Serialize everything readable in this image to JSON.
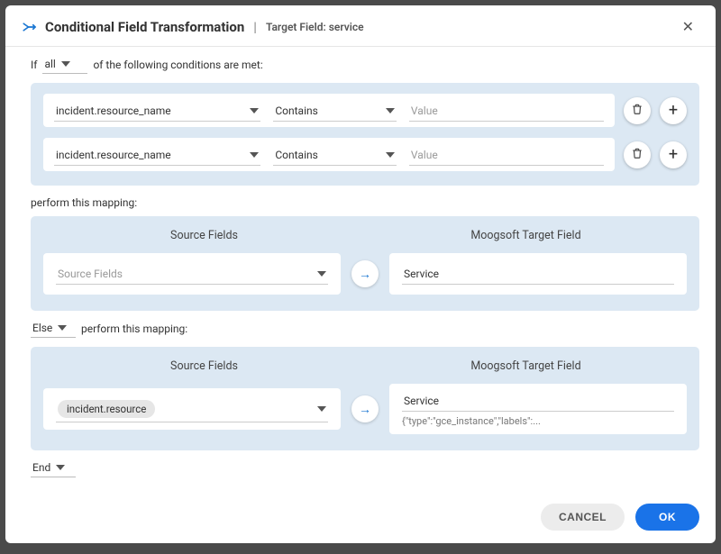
{
  "header": {
    "title": "Conditional Field Transformation",
    "target_label": "Target Field: service"
  },
  "if_clause": {
    "prefix": "If",
    "quantifier": "all",
    "suffix": "of the following conditions are met:"
  },
  "conditions": [
    {
      "field": "incident.resource_name",
      "operator": "Contains",
      "value_placeholder": "Value"
    },
    {
      "field": "incident.resource_name",
      "operator": "Contains",
      "value_placeholder": "Value"
    }
  ],
  "perform_label": "perform this mapping:",
  "map_headers": {
    "source": "Source Fields",
    "target": "Moogsoft Target Field"
  },
  "mapping_if": {
    "source_placeholder": "Source Fields",
    "target": "Service"
  },
  "else_clause": {
    "label": "Else",
    "suffix": "perform this mapping:"
  },
  "mapping_else": {
    "source_chip": "incident.resource",
    "target": "Service",
    "target_sub": "{\"type\":\"gce_instance\",\"labels\":..."
  },
  "end_label": "End",
  "buttons": {
    "cancel": "CANCEL",
    "ok": "OK"
  }
}
